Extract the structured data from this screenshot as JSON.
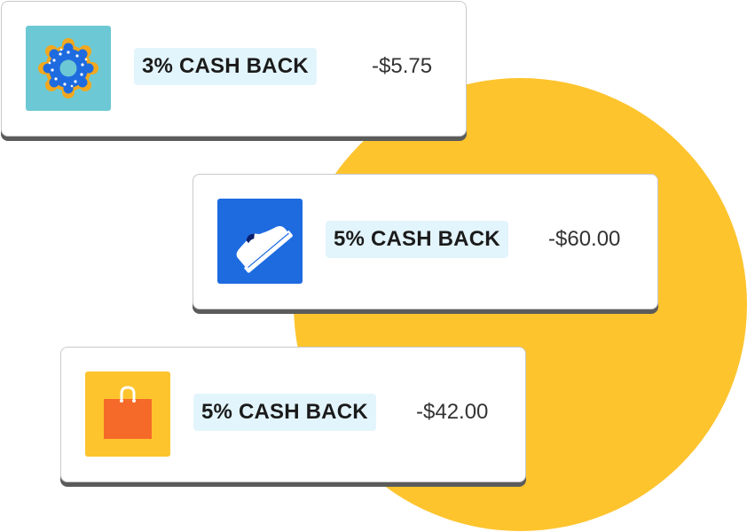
{
  "colors": {
    "accent_circle": "#FDC42E",
    "badge_background": "#E3F5FC",
    "donut_tile": "#6CC8D4",
    "shoe_tile": "#1E6BE0",
    "bag_tile": "#FDC42E"
  },
  "transactions": [
    {
      "icon": "donut-icon",
      "cashback_label": "3% CASH BACK",
      "amount": "-$5.75"
    },
    {
      "icon": "sneaker-icon",
      "cashback_label": "5% CASH BACK",
      "amount": "-$60.00"
    },
    {
      "icon": "shopping-bag-icon",
      "cashback_label": "5% CASH BACK",
      "amount": "-$42.00"
    }
  ]
}
